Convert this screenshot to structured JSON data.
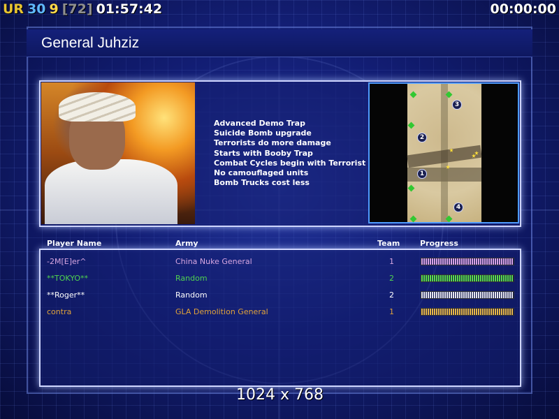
{
  "hud": {
    "ur": "UR",
    "players": "30",
    "count": "9",
    "bracket": "[72]",
    "clock": "01:57:42",
    "timer": "00:00:00"
  },
  "title": "General Juhziz",
  "features": [
    "Advanced Demo Trap",
    "Suicide Bomb upgrade",
    "Terrorists do more damage",
    "Starts with Booby Trap",
    "Combat Cycles begin with Terrorist",
    "No camouflaged units",
    "Bomb Trucks cost less"
  ],
  "map": {
    "markers": [
      "1",
      "2",
      "3",
      "4"
    ]
  },
  "table": {
    "headers": {
      "name": "Player Name",
      "army": "Army",
      "team": "Team",
      "progress": "Progress"
    },
    "rows": [
      {
        "name": "-2M[E]er^",
        "army": "China Nuke General",
        "team": "1",
        "color": "#d7a6e0",
        "bar": "#d9a3e6",
        "progress": 1.0
      },
      {
        "name": "**TOKYO**",
        "army": "Random",
        "team": "2",
        "color": "#4fd24f",
        "bar": "#5ddc4a",
        "progress": 1.0
      },
      {
        "name": "**Roger**",
        "army": "Random",
        "team": "2",
        "color": "#ffffff",
        "bar": "#e6e6f0",
        "progress": 1.0
      },
      {
        "name": "contra",
        "army": "GLA Demolition General",
        "team": "1",
        "color": "#e0a23a",
        "bar": "#e8b84a",
        "progress": 1.0
      }
    ]
  },
  "resolution": "1024 x 768"
}
